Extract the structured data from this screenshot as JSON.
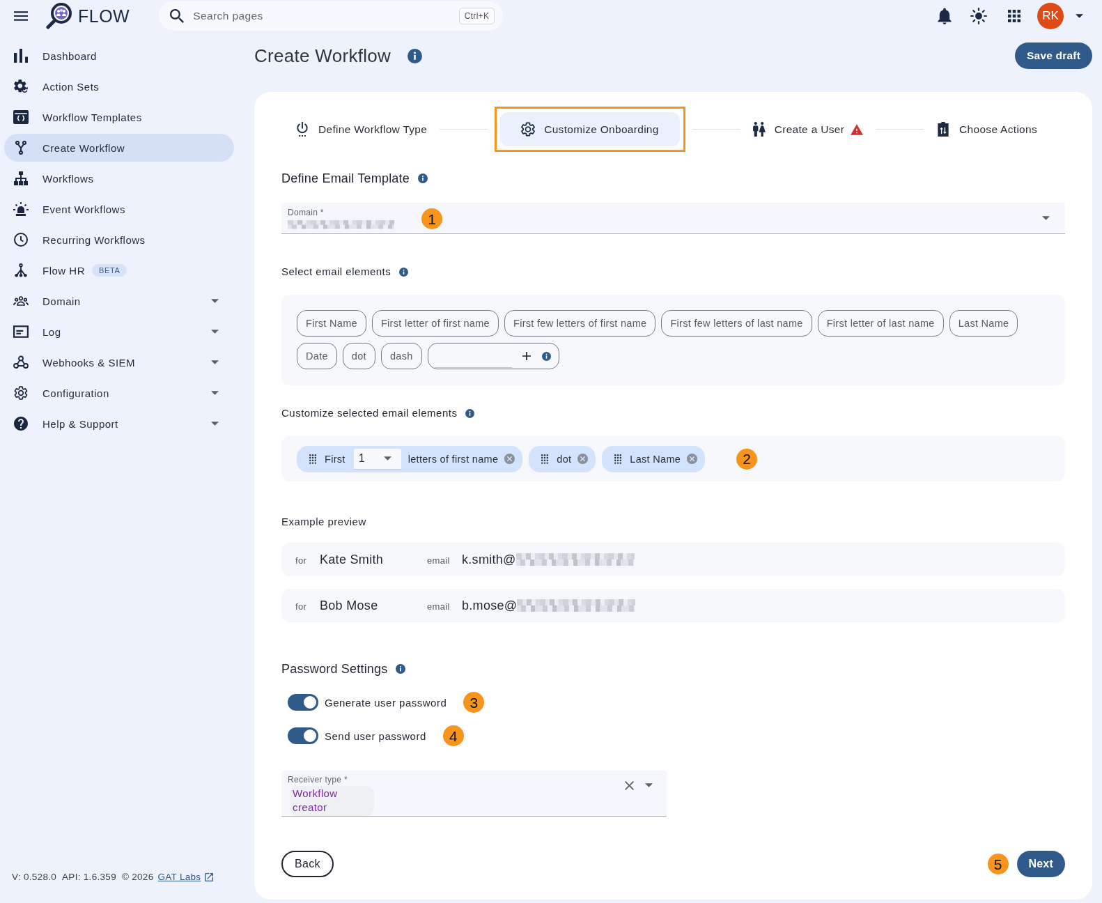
{
  "header": {
    "app_name": "FLOW",
    "search": {
      "placeholder": "Search pages",
      "shortcut": "Ctrl+K"
    },
    "avatar_initials": "RK"
  },
  "sidebar": {
    "items": [
      {
        "label": "Dashboard",
        "selected": false,
        "expandable": false
      },
      {
        "label": "Action Sets",
        "selected": false,
        "expandable": false
      },
      {
        "label": "Workflow Templates",
        "selected": false,
        "expandable": false
      },
      {
        "label": "Create Workflow",
        "selected": true,
        "expandable": false
      },
      {
        "label": "Workflows",
        "selected": false,
        "expandable": false
      },
      {
        "label": "Event Workflows",
        "selected": false,
        "expandable": false
      },
      {
        "label": "Recurring Workflows",
        "selected": false,
        "expandable": false
      },
      {
        "label": "Flow HR",
        "badge": "BETA",
        "selected": false,
        "expandable": false
      },
      {
        "label": "Domain",
        "selected": false,
        "expandable": true
      },
      {
        "label": "Log",
        "selected": false,
        "expandable": true
      },
      {
        "label": "Webhooks & SIEM",
        "selected": false,
        "expandable": true
      },
      {
        "label": "Configuration",
        "selected": false,
        "expandable": true
      },
      {
        "label": "Help & Support",
        "selected": false,
        "expandable": true
      }
    ],
    "footer": {
      "version": "V: 0.528.0",
      "api": "API: 1.6.359",
      "copyright": "© 2026",
      "link": "GAT Labs"
    }
  },
  "page": {
    "title": "Create Workflow",
    "info": true,
    "save_button": "Save draft"
  },
  "stepper": [
    {
      "label": "Define Workflow Type",
      "selected": false,
      "warning": false
    },
    {
      "label": "Customize Onboarding",
      "selected": true,
      "warning": false
    },
    {
      "label": "Create a User",
      "selected": false,
      "warning": true
    },
    {
      "label": "Choose Actions",
      "selected": false,
      "warning": false
    }
  ],
  "email_template": {
    "heading": "Define Email Template",
    "info": true,
    "domain_field": {
      "label": "Domain *",
      "value_redacted": true
    },
    "annotation": "1"
  },
  "email_elements": {
    "heading": "Select email elements",
    "info": true,
    "chips": [
      "First Name",
      "First letter of first name",
      "First few letters of first name",
      "First few letters of last name",
      "First letter of last name",
      "Last Name",
      "Date",
      "dot",
      "dash"
    ]
  },
  "selected_elements": {
    "heading": "Customize selected email elements",
    "info": true,
    "chips": [
      {
        "kind": "count",
        "prefix": "First",
        "value": "1",
        "suffix": "letters of first name"
      },
      {
        "kind": "plain",
        "label": "dot"
      },
      {
        "kind": "plain",
        "label": "Last Name"
      }
    ],
    "annotation": "2"
  },
  "example_preview": {
    "heading": "Example preview",
    "rows": [
      {
        "for_label": "for",
        "name": "Kate Smith",
        "email_label": "email",
        "email": "k.smith@",
        "email_redacted": true
      },
      {
        "for_label": "for",
        "name": "Bob Mose",
        "email_label": "email",
        "email": "b.mose@",
        "email_redacted": true
      }
    ]
  },
  "password_settings": {
    "heading": "Password Settings",
    "info": true,
    "toggles": [
      {
        "label": "Generate user password",
        "on": true,
        "annotation": "3"
      },
      {
        "label": "Send user password",
        "on": true,
        "annotation": "4"
      }
    ],
    "receiver_field": {
      "label": "Receiver type *",
      "value": "Workflow creator"
    }
  },
  "actions": {
    "back_button": "Back",
    "next_button": "Next",
    "annotation": "5"
  }
}
